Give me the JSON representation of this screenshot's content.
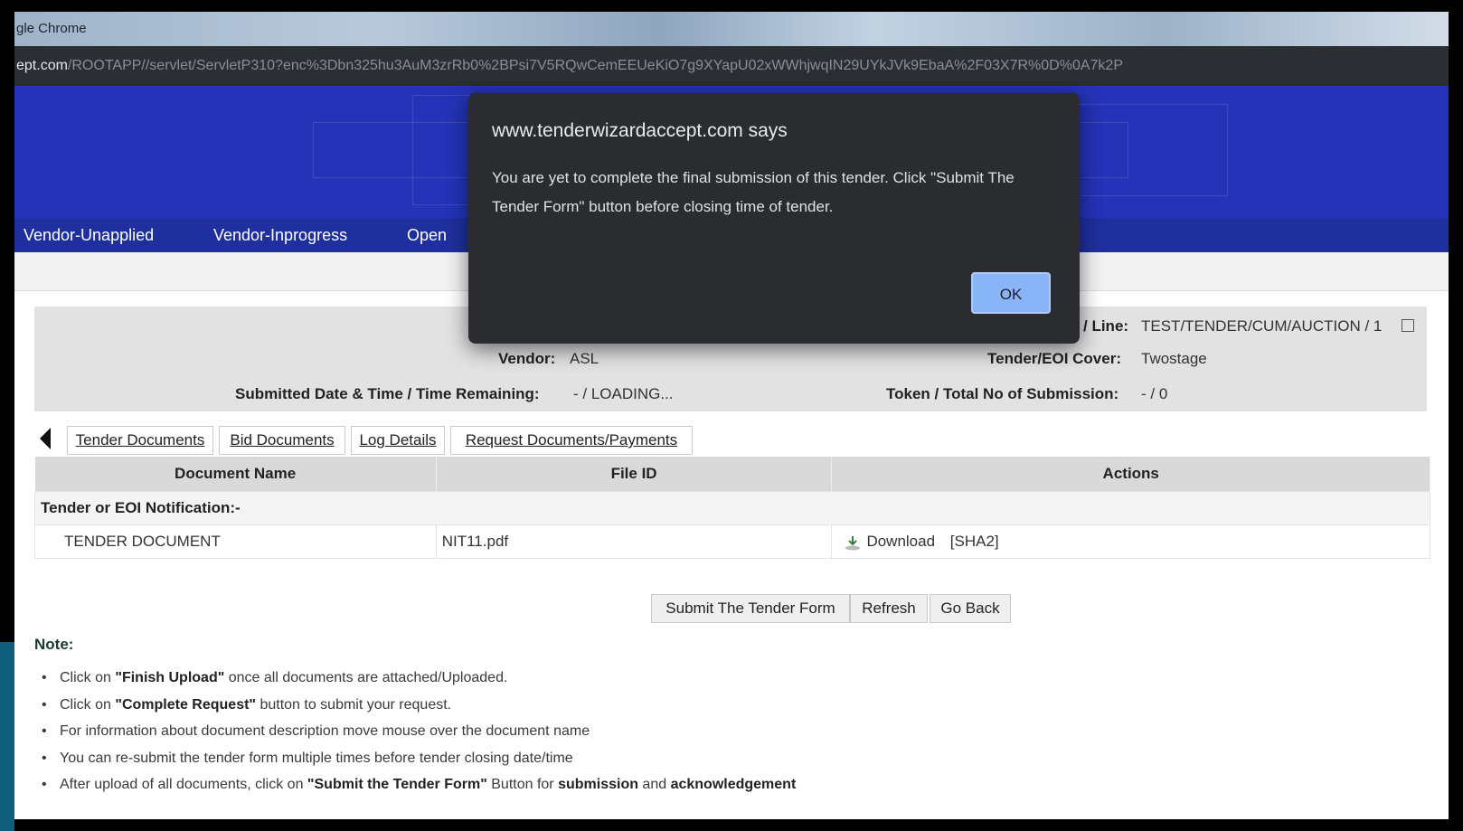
{
  "browser": {
    "title": "gle Chrome",
    "url_host": "ept.com",
    "url_path": "/ROOTAPP//servlet/ServletP310?enc%3Dbn325hu3AuM3zrRb0%2BPsi7V5RQwCemEEUeKiO7g9XYapU02xWWhjwqIN29UYkJVk9EbaA%2F03X7R%0D%0A7k2P"
  },
  "menu": {
    "items": [
      {
        "label": "Vendor-Unapplied"
      },
      {
        "label": "Vendor-Inprogress"
      },
      {
        "label": "Open"
      }
    ]
  },
  "info": {
    "line_label": "/ Line:",
    "line_value": "TEST/TENDER/CUM/AUCTION / 1",
    "vendor_label": "Vendor:",
    "vendor_value": "ASL",
    "cover_label": "Tender/EOI Cover:",
    "cover_value": "Twostage",
    "submitted_label": "Submitted Date & Time / Time Remaining:",
    "submitted_value": "- / LOADING...",
    "token_label": "Token / Total No of Submission:",
    "token_value": "- / 0"
  },
  "tabs": [
    {
      "label": "Tender Documents"
    },
    {
      "label": "Bid Documents"
    },
    {
      "label": "Log Details"
    },
    {
      "label": "Request Documents/Payments"
    }
  ],
  "table": {
    "headers": [
      "Document Name",
      "File ID",
      "Actions"
    ],
    "section": "Tender or EOI Notification:-",
    "rows": [
      {
        "name": "TENDER DOCUMENT",
        "file": "NIT11.pdf",
        "action": "Download",
        "hash": "[SHA2]"
      }
    ]
  },
  "buttons": {
    "submit": "Submit The Tender Form",
    "refresh": "Refresh",
    "back": "Go Back"
  },
  "note": {
    "title": "Note:",
    "items": [
      {
        "pre": "Click on ",
        "bold": "\"Finish Upload\"",
        "post": " once all documents are attached/Uploaded."
      },
      {
        "pre": "Click on ",
        "bold": "\"Complete Request\"",
        "post": " button to submit your request."
      },
      {
        "pre": "For information about document description move mouse over the document name",
        "bold": "",
        "post": ""
      },
      {
        "pre": "You can re-submit the tender form multiple times before tender closing date/time",
        "bold": "",
        "post": ""
      },
      {
        "pre": "After upload of all documents, click on ",
        "bold": "\"Submit the Tender Form\"",
        "post": " Button for ",
        "bold2": "submission",
        "mid": " and ",
        "bold3": "acknowledgement"
      }
    ]
  },
  "dialog": {
    "title": "www.tenderwizardaccept.com says",
    "message": "You are yet to complete the final submission of this tender. Click \"Submit The Tender Form\" button before closing time of tender.",
    "ok": "OK"
  }
}
